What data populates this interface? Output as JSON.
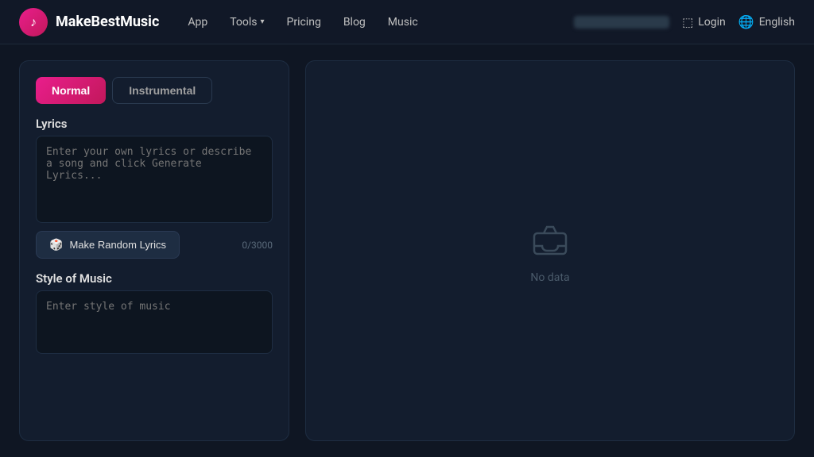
{
  "header": {
    "logo_icon": "♪",
    "logo_text": "MakeBestMusic",
    "nav": {
      "app_label": "App",
      "tools_label": "Tools",
      "tools_has_dropdown": true,
      "pricing_label": "Pricing",
      "blog_label": "Blog",
      "music_label": "Music"
    },
    "login_label": "Login",
    "lang_label": "English"
  },
  "left_panel": {
    "tab_normal_label": "Normal",
    "tab_instrumental_label": "Instrumental",
    "lyrics_section_label": "Lyrics",
    "lyrics_placeholder": "Enter your own lyrics or describe a song and click Generate Lyrics...",
    "lyrics_value": "",
    "make_random_label": "Make Random Lyrics",
    "char_count": "0/3000",
    "style_section_label": "Style of Music",
    "style_placeholder": "Enter style of music",
    "style_value": ""
  },
  "right_panel": {
    "no_data_label": "No data"
  }
}
